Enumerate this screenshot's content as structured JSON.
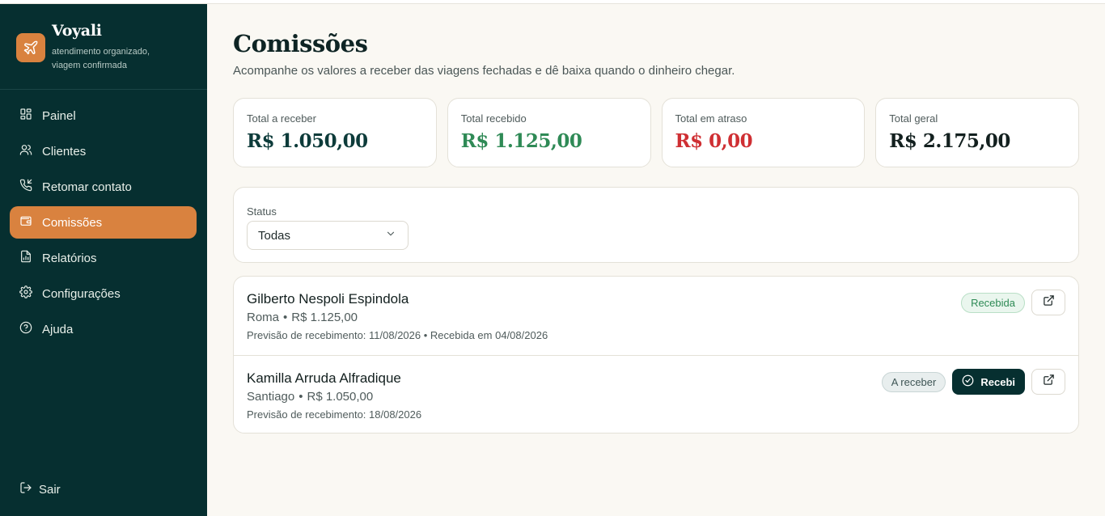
{
  "brand": {
    "name": "Voyali",
    "tagline": "atendimento organizado, viagem confirmada",
    "icon": "plane-icon",
    "accent": "#d9823f",
    "sidebar_bg": "#062f30"
  },
  "sidebar": {
    "items": [
      {
        "label": "Painel",
        "icon": "dashboard-icon",
        "active": false
      },
      {
        "label": "Clientes",
        "icon": "users-icon",
        "active": false
      },
      {
        "label": "Retomar contato",
        "icon": "phone-callback-icon",
        "active": false
      },
      {
        "label": "Comissões",
        "icon": "wallet-icon",
        "active": true
      },
      {
        "label": "Relatórios",
        "icon": "report-icon",
        "active": false
      },
      {
        "label": "Configurações",
        "icon": "gear-icon",
        "active": false
      },
      {
        "label": "Ajuda",
        "icon": "help-icon",
        "active": false
      }
    ],
    "logout_label": "Sair"
  },
  "page": {
    "title": "Comissões",
    "subtitle": "Acompanhe os valores a receber das viagens fechadas e dê baixa quando o dinheiro chegar."
  },
  "stats": [
    {
      "label": "Total a receber",
      "value": "R$ 1.050,00",
      "color": "#0d3b3a"
    },
    {
      "label": "Total recebido",
      "value": "R$ 1.125,00",
      "color": "#2f8a56"
    },
    {
      "label": "Total em atraso",
      "value": "R$ 0,00",
      "color": "#cf2f33"
    },
    {
      "label": "Total geral",
      "value": "R$ 2.175,00",
      "color": "#13201f"
    }
  ],
  "filter": {
    "label": "Status",
    "selected": "Todas"
  },
  "commissions": [
    {
      "name": "Gilberto Nespoli Espindola",
      "destination": "Roma",
      "amount": "R$ 1.125,00",
      "dates": "Previsão de recebimento: 11/08/2026 • Recebida em 04/08/2026",
      "status": "Recebida"
    },
    {
      "name": "Kamilla Arruda Alfradique",
      "destination": "Santiago",
      "amount": "R$ 1.050,00",
      "dates": "Previsão de recebimento: 18/08/2026",
      "status": "A receber",
      "action_label": "Recebi"
    }
  ]
}
